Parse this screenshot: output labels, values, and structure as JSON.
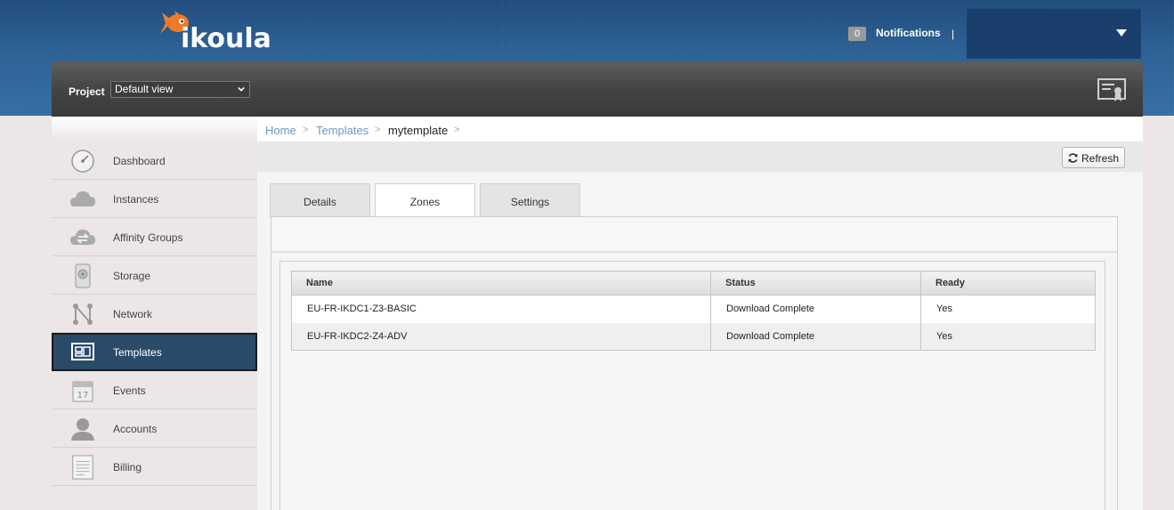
{
  "header": {
    "logo_text": "ikoula",
    "notifications_count": "0",
    "notifications_label": "Notifications",
    "separator": "|"
  },
  "projectbar": {
    "label": "Project",
    "selected_project": "Default view"
  },
  "sidebar": {
    "items": [
      {
        "label": "Dashboard",
        "icon": "dashboard-gauge-icon"
      },
      {
        "label": "Instances",
        "icon": "cloud-icon"
      },
      {
        "label": "Affinity Groups",
        "icon": "cloud-arrows-icon"
      },
      {
        "label": "Storage",
        "icon": "hard-disk-icon"
      },
      {
        "label": "Network",
        "icon": "network-nodes-icon"
      },
      {
        "label": "Templates",
        "icon": "templates-icon",
        "active": true
      },
      {
        "label": "Events",
        "icon": "calendar-icon"
      },
      {
        "label": "Accounts",
        "icon": "user-icon"
      },
      {
        "label": "Billing",
        "icon": "document-icon"
      }
    ]
  },
  "breadcrumb": {
    "home": "Home",
    "templates": "Templates",
    "current": "mytemplate",
    "arrow": ">"
  },
  "toolbar": {
    "refresh_label": "Refresh"
  },
  "tabs": [
    {
      "label": "Details"
    },
    {
      "label": "Zones",
      "active": true
    },
    {
      "label": "Settings"
    }
  ],
  "zones_table": {
    "columns": [
      "Name",
      "Status",
      "Ready"
    ],
    "rows": [
      [
        "EU-FR-IKDC1-Z3-BASIC",
        "Download Complete",
        "Yes"
      ],
      [
        "EU-FR-IKDC2-Z4-ADV",
        "Download Complete",
        "Yes"
      ]
    ]
  },
  "colors": {
    "accent_blue": "#2a5f94",
    "active_nav": "#2a4a6a",
    "link": "#6b97c4",
    "logo_fish": "#f07a2a"
  }
}
